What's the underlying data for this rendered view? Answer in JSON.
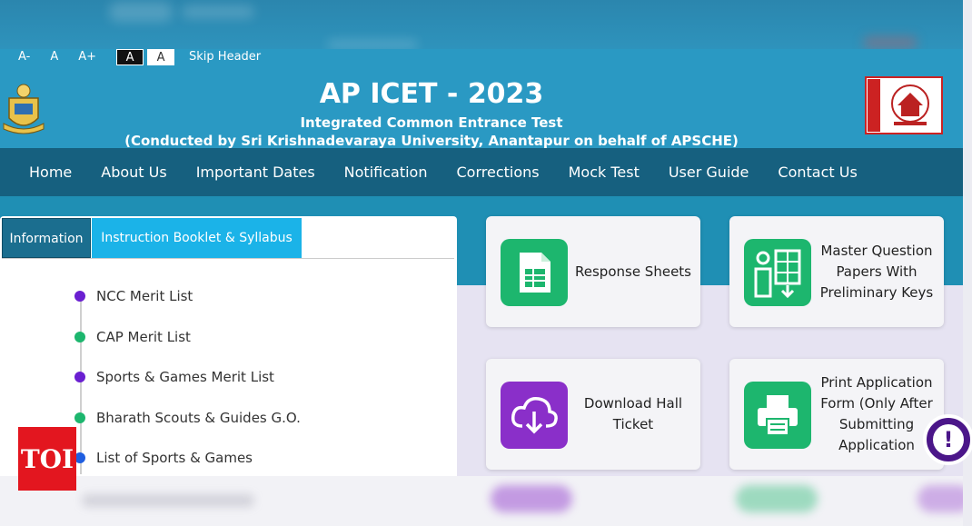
{
  "accessibility": {
    "decrease": "A-",
    "normal": "A",
    "increase": "A+",
    "dark_theme": "A",
    "light_theme": "A",
    "skip": "Skip Header"
  },
  "header": {
    "title": "AP ICET - 2023",
    "subtitle": "Integrated Common Entrance Test",
    "conducted_by": "(Conducted by Sri Krishnadevaraya University, Anantapur on behalf of APSCHE)"
  },
  "nav": {
    "items": [
      "Home",
      "About Us",
      "Important Dates",
      "Notification",
      "Corrections",
      "Mock Test",
      "User Guide",
      "Contact Us"
    ]
  },
  "panel": {
    "tabs": [
      "Information",
      "Instruction Booklet & Syllabus"
    ],
    "links": [
      {
        "label": "NCC Merit List",
        "dot_color": "#6a1fd1"
      },
      {
        "label": "CAP Merit List",
        "dot_color": "#1db66e"
      },
      {
        "label": "Sports & Games Merit List",
        "dot_color": "#6a1fd1"
      },
      {
        "label": "Bharath Scouts & Guides G.O.",
        "dot_color": "#1db66e"
      },
      {
        "label": "List of Sports & Games",
        "dot_color": "#1f5ee0"
      }
    ]
  },
  "cards": [
    {
      "label": "Response Sheets",
      "icon": "spreadsheet-icon",
      "color": "green"
    },
    {
      "label": "Master Question Papers With Preliminary Keys",
      "icon": "answer-key-icon",
      "color": "green"
    },
    {
      "label": "Download Hall Ticket",
      "icon": "cloud-download-icon",
      "color": "purple"
    },
    {
      "label": "Print Application Form (Only After Submitting Application",
      "icon": "printer-icon",
      "color": "green"
    }
  ],
  "watermark": {
    "text": "TOI"
  },
  "help": {
    "symbol": "!"
  },
  "colors": {
    "header": "#2a99c3",
    "nav": "#16607f",
    "green": "#1db66e",
    "purple": "#8a2fc9",
    "toi_red": "#e3161f"
  }
}
